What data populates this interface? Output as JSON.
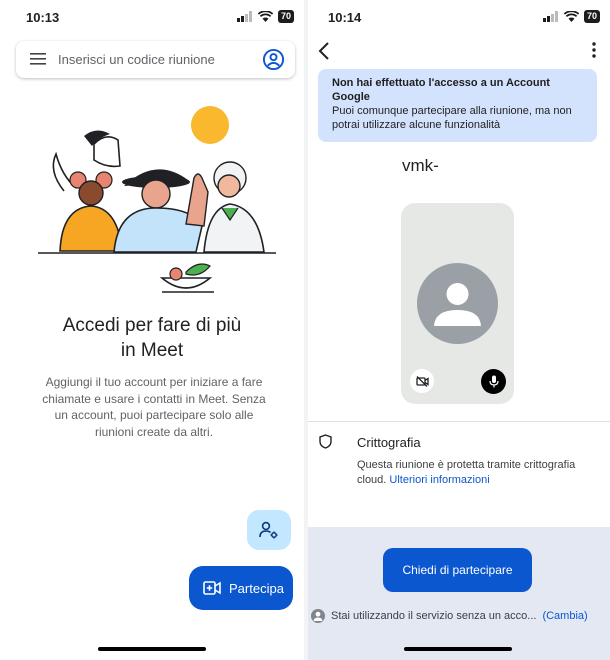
{
  "left": {
    "status": {
      "time": "10:13",
      "battery": "70"
    },
    "search": {
      "placeholder": "Inserisci un codice riunione"
    },
    "title_line1": "Accedi per fare di più",
    "title_line2": "in Meet",
    "description": "Aggiungi il tuo account per iniziare a fare chiamate e usare i contatti in Meet. Senza un account, puoi partecipare solo alle riunioni create da altri.",
    "join_button": "Partecipa",
    "icons": {
      "menu": "hamburger-icon",
      "account": "account-circle-icon",
      "manage": "person-settings-icon",
      "join": "video-add-icon"
    }
  },
  "right": {
    "status": {
      "time": "10:14",
      "battery": "70"
    },
    "banner": {
      "title": "Non hai effettuato l'accesso a un Account Google",
      "body": "Puoi comunque partecipare alla riunione, ma non potrai utilizzare alcune funzionalità"
    },
    "meeting_code": "vmk-",
    "encryption": {
      "title": "Crittografia",
      "text": "Questa riunione è protetta tramite crittografia cloud.",
      "link": "Ulteriori informazioni"
    },
    "ask_button": "Chiedi di partecipare",
    "guest_text": "Stai utilizzando il servizio senza un acco...",
    "change_link": "(Cambia)"
  },
  "colors": {
    "primary": "#0b57d0",
    "banner": "#d3e3fd",
    "fab_small": "#c2e7ff",
    "bottom_panel": "#e3e8f3",
    "sun": "#f9b82e"
  }
}
